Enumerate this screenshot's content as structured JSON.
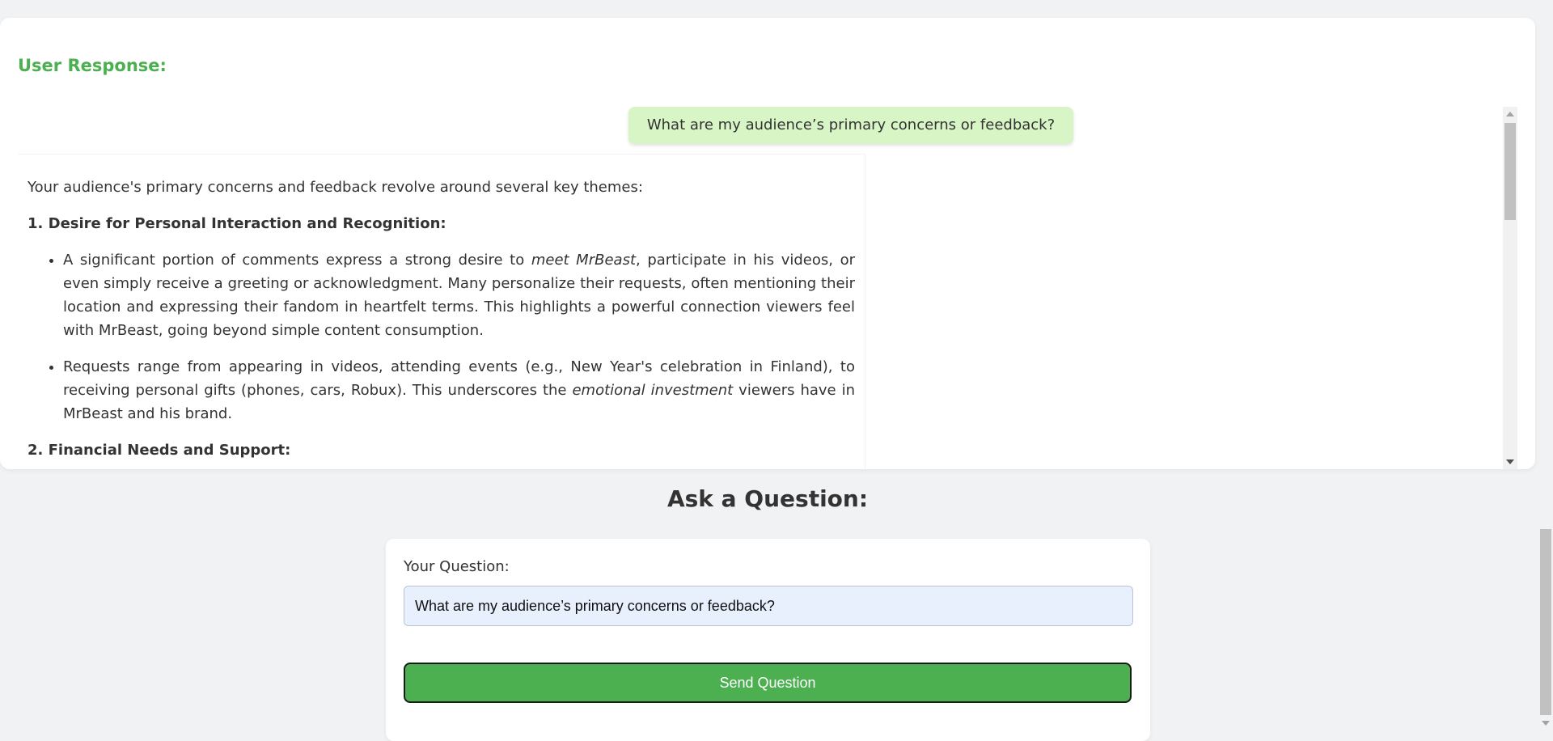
{
  "response_card": {
    "heading": "User Response:",
    "user_message": "What are my audience’s primary concerns or feedback?",
    "bot_message": {
      "intro": "Your audience's primary concerns and feedback revolve around several key themes:",
      "section1_title": "1. Desire for Personal Interaction and Recognition:",
      "section1_bullets": [
        {
          "before": "A significant portion of comments express a strong desire to ",
          "emph": "meet MrBeast",
          "after": ", participate in his videos, or even simply receive a greeting or acknowledgment. Many personalize their requests, often mentioning their location and expressing their fandom in heartfelt terms. This highlights a powerful connection viewers feel with MrBeast, going beyond simple content consumption."
        },
        {
          "before": "Requests range from appearing in videos, attending events (e.g., New Year's celebration in Finland), to receiving personal gifts (phones, cars, Robux). This underscores the ",
          "emph": "emotional investment",
          "after": " viewers have in MrBeast and his brand."
        }
      ],
      "section2_title": "2. Financial Needs and Support:"
    }
  },
  "ask": {
    "title": "Ask a Question:",
    "label": "Your Question:",
    "input_value": "What are my audience’s primary concerns or feedback?",
    "button_label": "Send Question"
  },
  "colors": {
    "accent_green": "#4caf50",
    "user_bubble": "#d8f5c6",
    "input_bg": "#e8f0fe",
    "page_bg": "#f1f2f4"
  }
}
